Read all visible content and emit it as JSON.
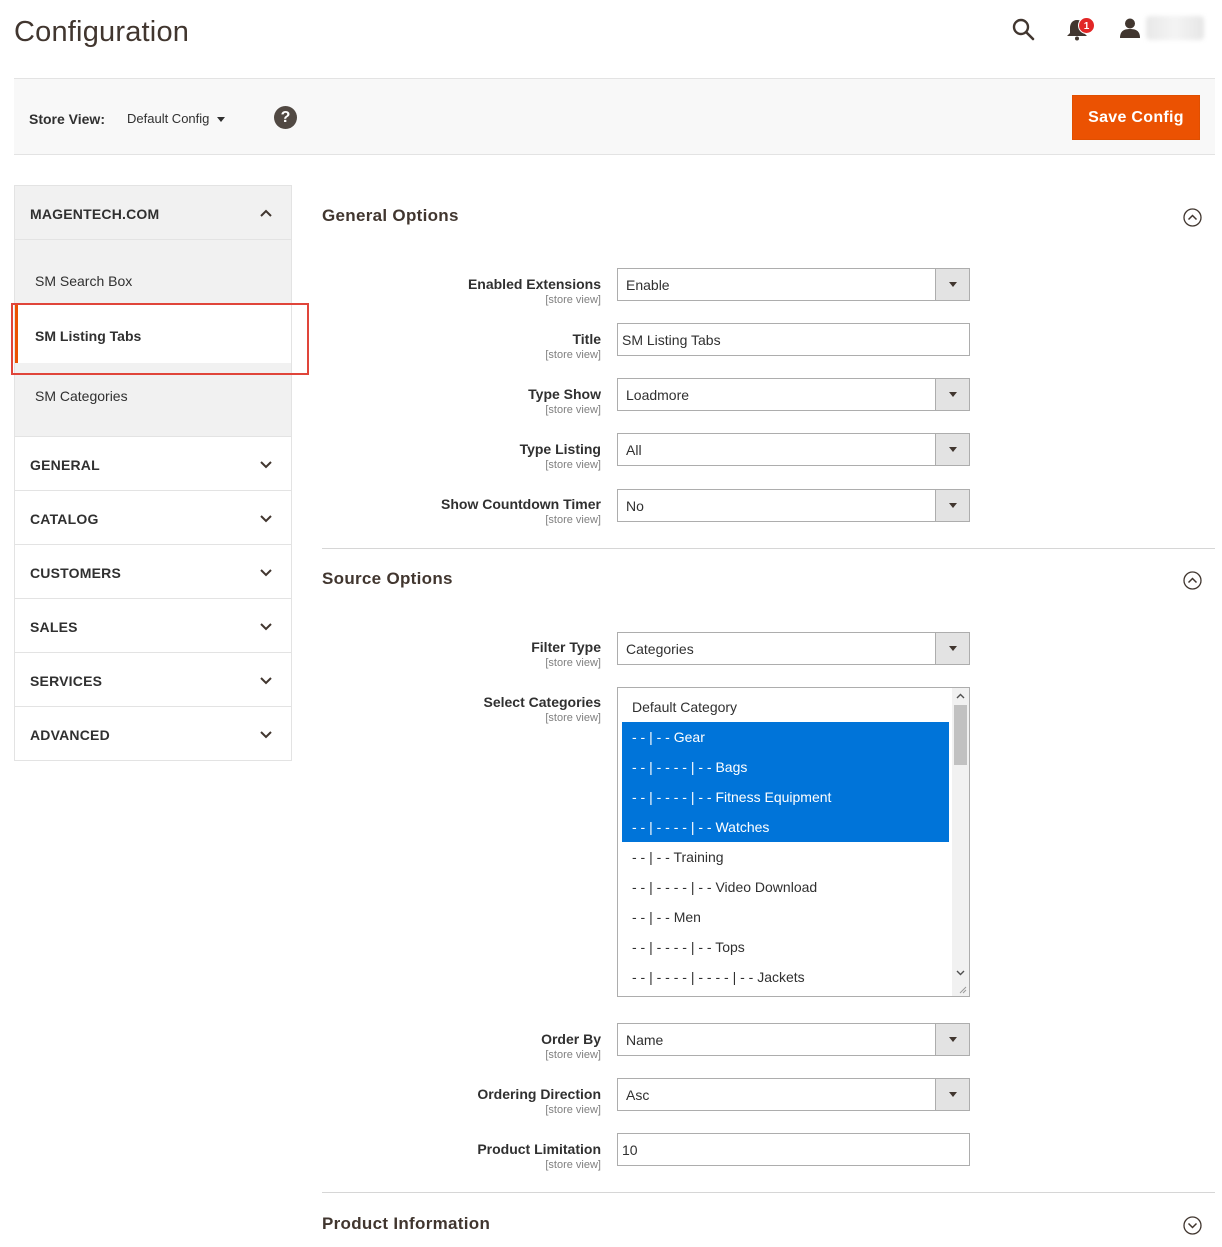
{
  "header": {
    "title": "Configuration",
    "notification_count": "1"
  },
  "store_bar": {
    "label": "Store View:",
    "selected": "Default Config",
    "help": "?",
    "save_label": "Save Config"
  },
  "sidebar": {
    "open_section": "MAGENTECH.COM",
    "sub_items": [
      "SM Search Box",
      "SM Listing Tabs",
      "SM Categories"
    ],
    "active_item": "SM Listing Tabs",
    "sections": [
      "GENERAL",
      "CATALOG",
      "CUSTOMERS",
      "SALES",
      "SERVICES",
      "ADVANCED"
    ]
  },
  "general_options": {
    "title": "General Options",
    "scope": "[store view]",
    "fields": [
      {
        "label": "Enabled Extensions",
        "value": "Enable"
      },
      {
        "label": "Title",
        "value": "SM Listing Tabs"
      },
      {
        "label": "Type Show",
        "value": "Loadmore"
      },
      {
        "label": "Type Listing",
        "value": "All"
      },
      {
        "label": "Show Countdown Timer",
        "value": "No"
      }
    ]
  },
  "source_options": {
    "title": "Source Options",
    "filter_type": {
      "label": "Filter Type",
      "value": "Categories"
    },
    "select_categories": {
      "label": "Select Categories",
      "options": [
        {
          "text": "Default Category",
          "selected": false
        },
        {
          "text": "- - | - - Gear",
          "selected": true
        },
        {
          "text": "- - | - - - - | - - Bags",
          "selected": true
        },
        {
          "text": "- - | - - - - | - - Fitness Equipment",
          "selected": true
        },
        {
          "text": "- - | - - - - | - - Watches",
          "selected": true
        },
        {
          "text": "- - | - - Training",
          "selected": false
        },
        {
          "text": "- - | - - - - | - - Video Download",
          "selected": false
        },
        {
          "text": "- - | - - Men",
          "selected": false
        },
        {
          "text": "- - | - - - - | - - Tops",
          "selected": false
        },
        {
          "text": "- - | - - - - | - - - - | - - Jackets",
          "selected": false
        }
      ]
    },
    "order_by": {
      "label": "Order By",
      "value": "Name"
    },
    "ordering_direction": {
      "label": "Ordering Direction",
      "value": "Asc"
    },
    "product_limitation": {
      "label": "Product Limitation",
      "value": "10"
    }
  },
  "product_information": {
    "title": "Product Information"
  },
  "colors": {
    "accent": "#eb5202",
    "selected_option": "#0074d9",
    "highlight_box": "#e0453a"
  }
}
